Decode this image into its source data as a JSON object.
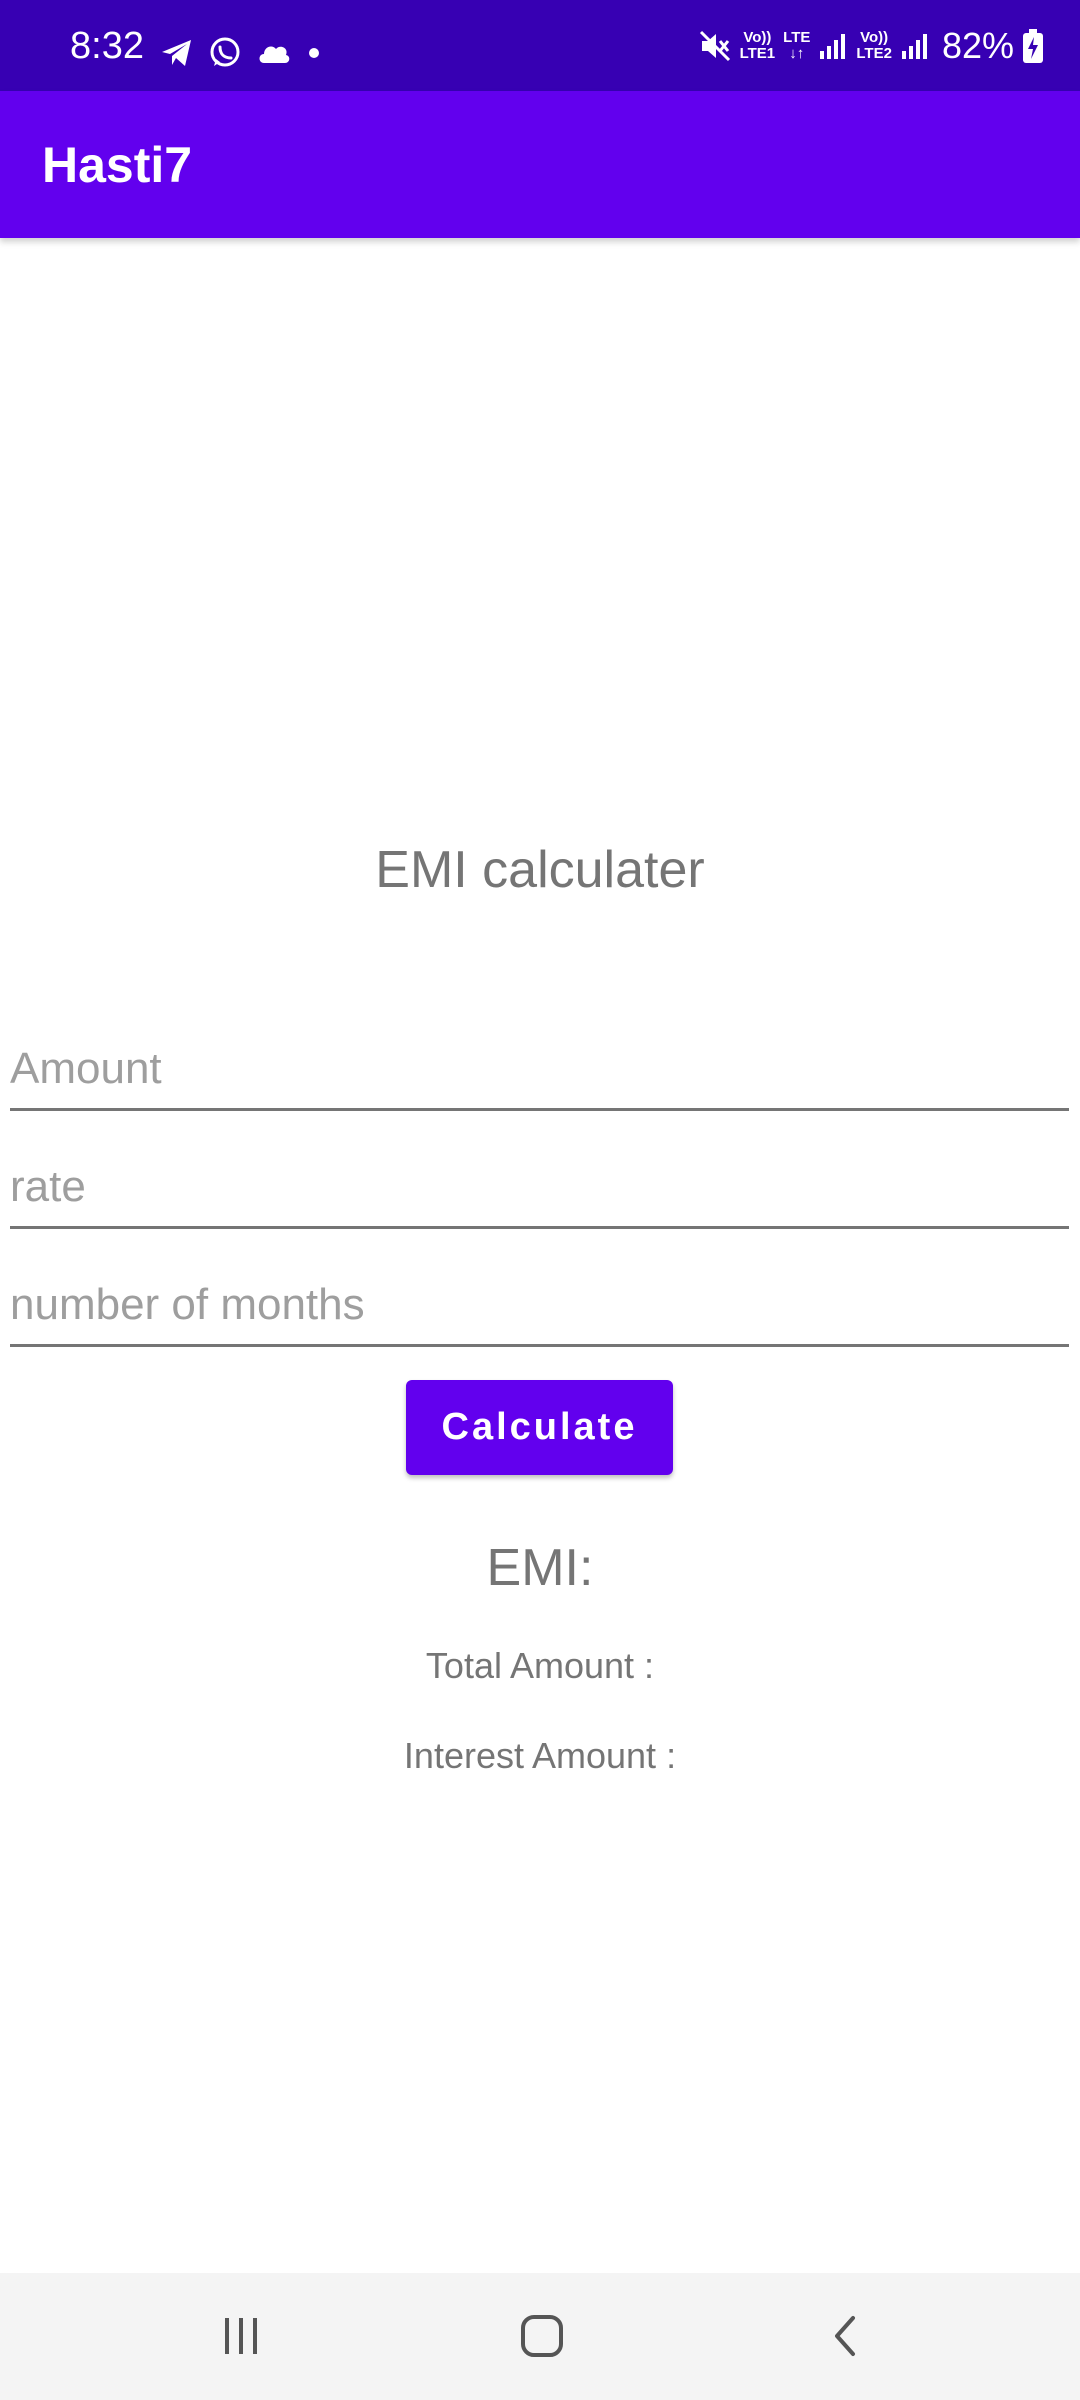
{
  "status_bar": {
    "time": "8:32",
    "left_icons": [
      "telegram-icon",
      "whatsapp-icon",
      "cloud-icon",
      "dot-icon"
    ],
    "sim1_top": "Vo))",
    "sim1_bottom": "LTE1",
    "lte_label": "LTE",
    "sim2_top": "Vo))",
    "sim2_bottom": "LTE2",
    "battery_percent": "82%"
  },
  "app_bar": {
    "title": "Hasti7"
  },
  "main": {
    "heading": "EMI calculater",
    "amount_placeholder": "Amount",
    "rate_placeholder": "rate",
    "months_placeholder": "number of months",
    "calculate_label": "Calculate",
    "emi_label": "EMI:",
    "total_amount_label": "Total Amount :",
    "interest_amount_label": "Interest Amount :"
  },
  "nav_bar": {
    "icons": [
      "recent-apps-icon",
      "home-icon",
      "back-icon"
    ]
  },
  "colors": {
    "status_bar": "#3700b3",
    "primary": "#6200ee",
    "text_secondary": "#757575"
  }
}
